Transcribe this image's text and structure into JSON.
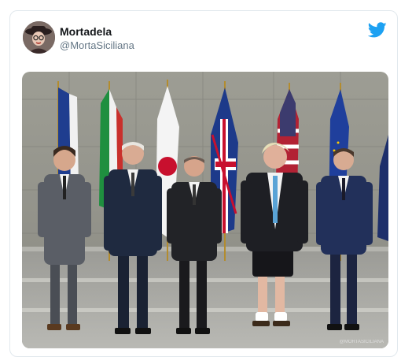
{
  "tweet": {
    "display_name": "Mortadela",
    "handle": "@MortaSiciliana",
    "watermark": "@MORTASICILIANA"
  },
  "colors": {
    "twitter_blue": "#1da1f2",
    "name_text": "#14171a",
    "handle_text": "#657786"
  },
  "icons": [
    "avatar",
    "twitter-bird-icon"
  ]
}
